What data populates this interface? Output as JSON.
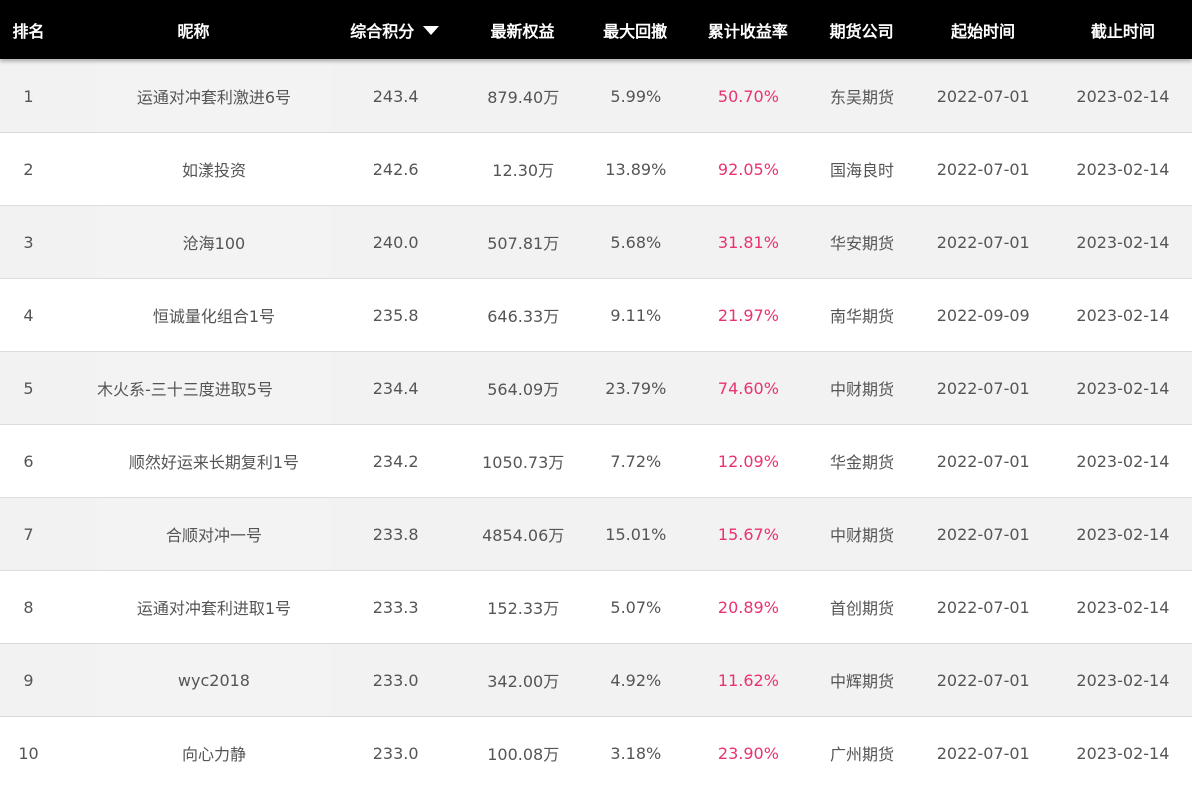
{
  "headers": {
    "rank": "排名",
    "nickname": "昵称",
    "score": "综合积分",
    "equity": "最新权益",
    "drawdown": "最大回撤",
    "return": "累计收益率",
    "company": "期货公司",
    "start": "起始时间",
    "end": "截止时间"
  },
  "rows": [
    {
      "rank": "1",
      "name": "运通对冲套利激进6号",
      "score": "243.4",
      "equity": "879.40万",
      "drawdown": "5.99%",
      "return": "50.70%",
      "company": "东吴期货",
      "start": "2022-07-01",
      "end": "2023-02-14"
    },
    {
      "rank": "2",
      "name": "如漾投资",
      "score": "242.6",
      "equity": "12.30万",
      "drawdown": "13.89%",
      "return": "92.05%",
      "company": "国海良时",
      "start": "2022-07-01",
      "end": "2023-02-14"
    },
    {
      "rank": "3",
      "name": "沧海100",
      "score": "240.0",
      "equity": "507.81万",
      "drawdown": "5.68%",
      "return": "31.81%",
      "company": "华安期货",
      "start": "2022-07-01",
      "end": "2023-02-14"
    },
    {
      "rank": "4",
      "name": "恒诚量化组合1号",
      "score": "235.8",
      "equity": "646.33万",
      "drawdown": "9.11%",
      "return": "21.97%",
      "company": "南华期货",
      "start": "2022-09-09",
      "end": "2023-02-14"
    },
    {
      "rank": "5",
      "name": "木火系-三十三度进取5号",
      "score": "234.4",
      "equity": "564.09万",
      "drawdown": "23.79%",
      "return": "74.60%",
      "company": "中财期货",
      "start": "2022-07-01",
      "end": "2023-02-14"
    },
    {
      "rank": "6",
      "name": "顺然好运来长期复利1号",
      "score": "234.2",
      "equity": "1050.73万",
      "drawdown": "7.72%",
      "return": "12.09%",
      "company": "华金期货",
      "start": "2022-07-01",
      "end": "2023-02-14"
    },
    {
      "rank": "7",
      "name": "合顺对冲一号",
      "score": "233.8",
      "equity": "4854.06万",
      "drawdown": "15.01%",
      "return": "15.67%",
      "company": "中财期货",
      "start": "2022-07-01",
      "end": "2023-02-14"
    },
    {
      "rank": "8",
      "name": "运通对冲套利进取1号",
      "score": "233.3",
      "equity": "152.33万",
      "drawdown": "5.07%",
      "return": "20.89%",
      "company": "首创期货",
      "start": "2022-07-01",
      "end": "2023-02-14"
    },
    {
      "rank": "9",
      "name": "wyc2018",
      "score": "233.0",
      "equity": "342.00万",
      "drawdown": "4.92%",
      "return": "11.62%",
      "company": "中辉期货",
      "start": "2022-07-01",
      "end": "2023-02-14"
    },
    {
      "rank": "10",
      "name": "向心力静",
      "score": "233.0",
      "equity": "100.08万",
      "drawdown": "3.18%",
      "return": "23.90%",
      "company": "广州期货",
      "start": "2022-07-01",
      "end": "2023-02-14"
    }
  ],
  "colors": {
    "header_bg": "#000000",
    "header_text": "#ffffff",
    "row_odd_bg": "#f2f2f2",
    "row_even_bg": "#ffffff",
    "text": "#555555",
    "return_text": "#e8336e"
  },
  "icons": {
    "sort": "sort-desc-triangle-icon"
  }
}
